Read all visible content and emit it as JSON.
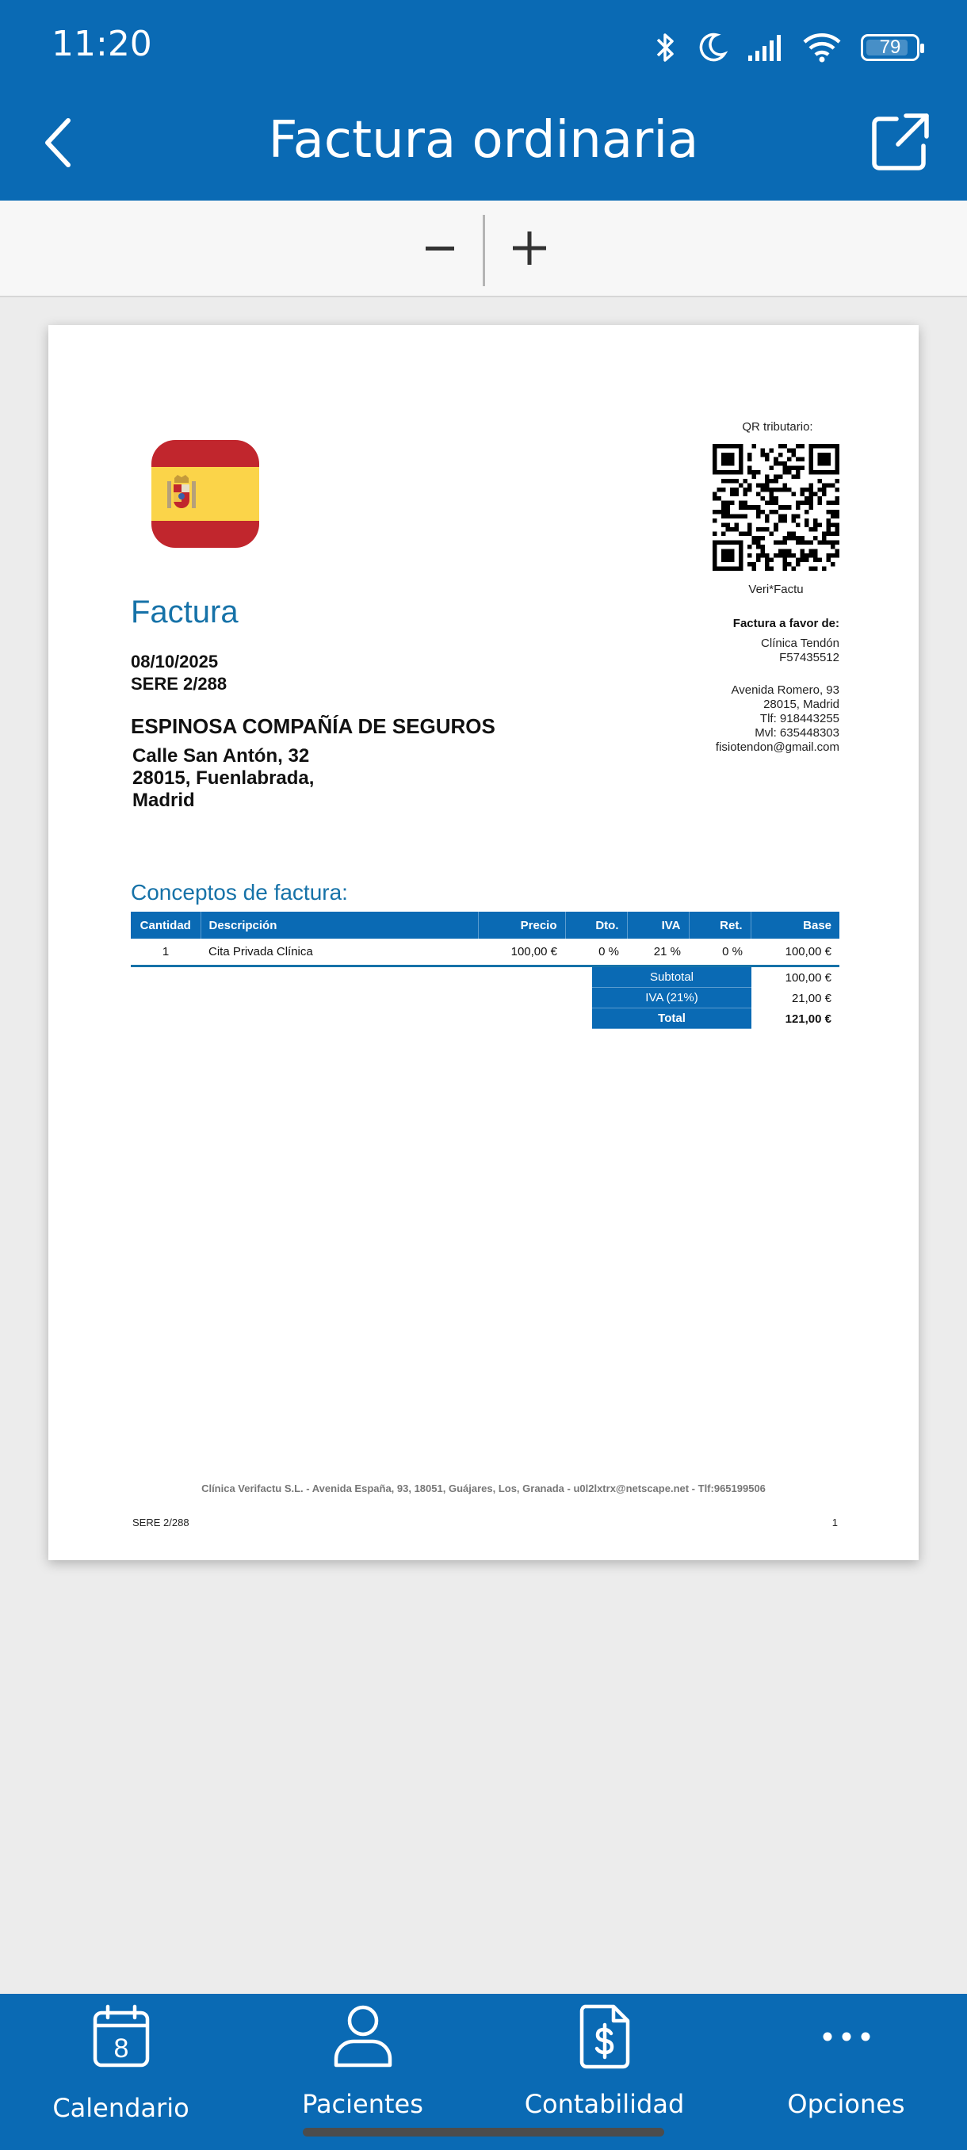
{
  "status": {
    "time": "11:20",
    "battery": "79"
  },
  "appbar": {
    "title": "Factura ordinaria"
  },
  "invoice": {
    "qr_label": "QR tributario:",
    "qr_caption": "Veri*Factu",
    "heading": "Factura",
    "date": "08/10/2025",
    "series": "SERE 2/288",
    "client_name": "ESPINOSA COMPAÑÍA DE SEGUROS",
    "client_address": [
      "Calle San Antón, 32",
      "28015, Fuenlabrada,",
      "Madrid"
    ],
    "issuer": {
      "title": "Factura a favor de:",
      "lines": [
        "Clínica Tendón",
        "F57435512",
        "",
        "Avenida Romero, 93",
        "28015, Madrid",
        "Tlf: 918443255",
        "Mvl: 635448303",
        "fisiotendon@gmail.com"
      ]
    },
    "concepts_title": "Conceptos de factura:",
    "table": {
      "headers": [
        "Cantidad",
        "Descripción",
        "Precio",
        "Dto.",
        "IVA",
        "Ret.",
        "Base"
      ],
      "rows": [
        [
          "1",
          "Cita Privada Clínica",
          "100,00 €",
          "0 %",
          "21 %",
          "0 %",
          "100,00 €"
        ]
      ]
    },
    "totals": [
      {
        "label": "Subtotal",
        "value": "100,00 €"
      },
      {
        "label": "IVA (21%)",
        "value": "21,00 €"
      },
      {
        "label": "Total",
        "value": "121,00 €"
      }
    ],
    "footer": "Clínica Verifactu S.L. - Avenida España, 93, 18051, Guájares, Los, Granada - u0l2lxtrx@netscape.net - Tlf:965199506",
    "footer_series": "SERE 2/288",
    "page_number": "1"
  },
  "nav": {
    "items": [
      {
        "label": "Calendario",
        "icon": "calendar-icon",
        "badge": "8"
      },
      {
        "label": "Pacientes",
        "icon": "person-icon"
      },
      {
        "label": "Contabilidad",
        "icon": "invoice-dollar-icon"
      },
      {
        "label": "Opciones",
        "icon": "more-dots-icon"
      }
    ]
  },
  "colors": {
    "primary": "#0a6ab4",
    "heading_blue": "#1672a8",
    "flag_red": "#c1262d",
    "flag_yellow": "#fbd449"
  }
}
